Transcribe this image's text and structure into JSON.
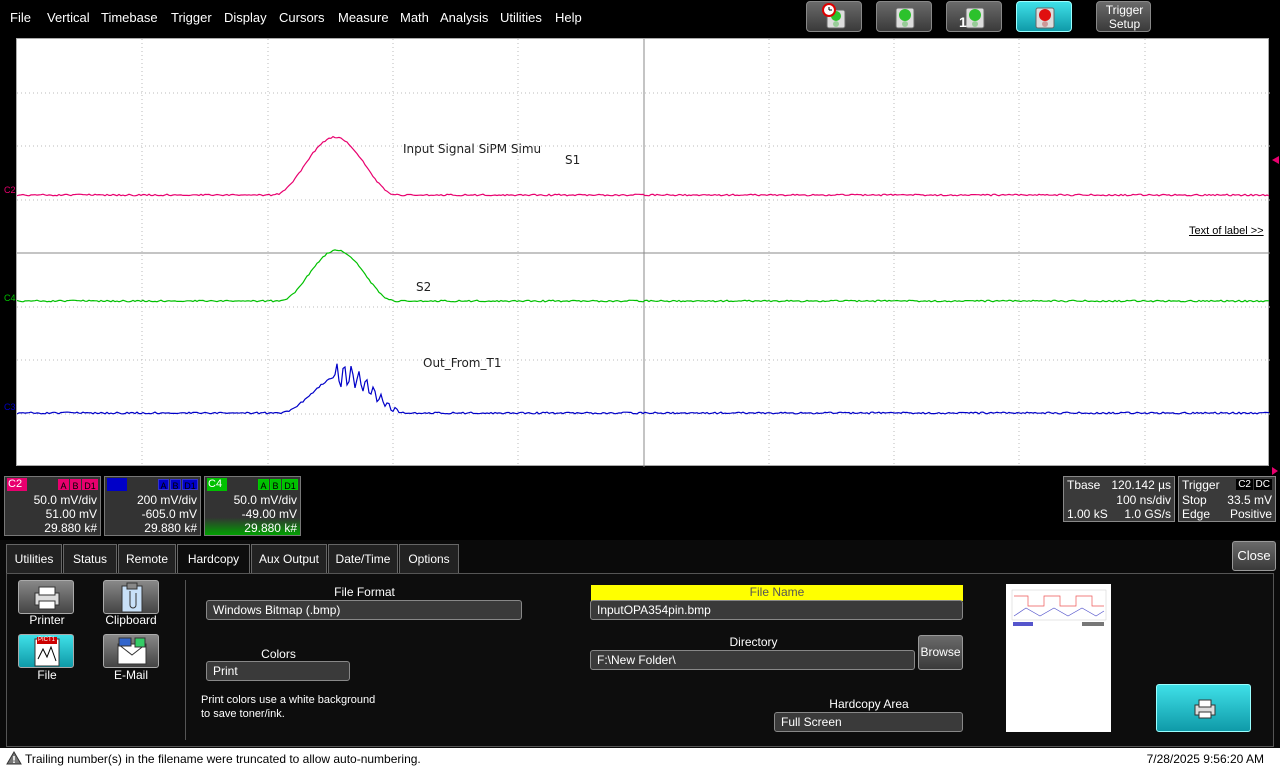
{
  "menu": [
    "File",
    "Vertical",
    "Timebase",
    "Trigger",
    "Display",
    "Cursors",
    "Measure",
    "Math",
    "Analysis",
    "Utilities",
    "Help"
  ],
  "toolbar": {
    "trigger_setup_label": "Trigger Setup",
    "single_badge": "1",
    "icons": [
      "auto-trigger-icon",
      "normal-trigger-icon",
      "single-trigger-icon",
      "stop-trigger-icon"
    ]
  },
  "traces": {
    "label_s1_text": "Input Signal  SiPM  Simu",
    "label_s1": "S1",
    "label_s2": "S2",
    "label_t1": "Out_From_T1",
    "c2_marker": "C2",
    "c4_marker": "C4",
    "c3_marker": "C3",
    "text_of_label": "Text of label >>",
    "colors": {
      "c2": "#e8006e",
      "c4": "#00c000",
      "c3": "#0000c8"
    }
  },
  "channels": [
    {
      "name": "C2",
      "vdiv": "50.0 mV/div",
      "offset": "51.00 mV",
      "count": "29.880 k#",
      "color": "#e8006e"
    },
    {
      "name": "C3",
      "vdiv": "200 mV/div",
      "offset": "-605.0 mV",
      "count": "29.880 k#",
      "color": "#0000c8"
    },
    {
      "name": "C4",
      "vdiv": "50.0 mV/div",
      "offset": "-49.00 mV",
      "count": "29.880 k#",
      "color": "#00c000"
    }
  ],
  "flags": [
    "A",
    "B",
    "D1"
  ],
  "timebase": {
    "title": "Tbase",
    "delay": "120.142 µs",
    "tdiv": "100 ns/div",
    "samples": "1.00 kS",
    "rate": "1.0 GS/s"
  },
  "trigger": {
    "title": "Trigger",
    "source": "C2",
    "coupling": "DC",
    "mode": "Stop",
    "level": "33.5 mV",
    "type": "Edge",
    "slope": "Positive"
  },
  "tabs": [
    "Utilities",
    "Status",
    "Remote",
    "Hardcopy",
    "Aux Output",
    "Date/Time",
    "Options"
  ],
  "close_label": "Close",
  "hardcopy": {
    "printer": "Printer",
    "clipboard": "Clipboard",
    "file": "File",
    "email": "E-Mail",
    "file_format_title": "File Format",
    "file_format": "Windows Bitmap (.bmp)",
    "colors_title": "Colors",
    "colors": "Print",
    "colors_note_1": "Print colors use a white background",
    "colors_note_2": "to save toner/ink.",
    "file_name_title": "File Name",
    "file_name": "InputOPA354pin.bmp",
    "directory_title": "Directory",
    "directory": "F:\\New Folder\\",
    "browse": "Browse",
    "area_title": "Hardcopy Area",
    "area": "Full Screen",
    "pict_badge": "PICT1"
  },
  "status": {
    "message": "Trailing number(s) in the filename were truncated to allow auto-numbering.",
    "datetime": "7/28/2025 9:56:20 AM"
  }
}
